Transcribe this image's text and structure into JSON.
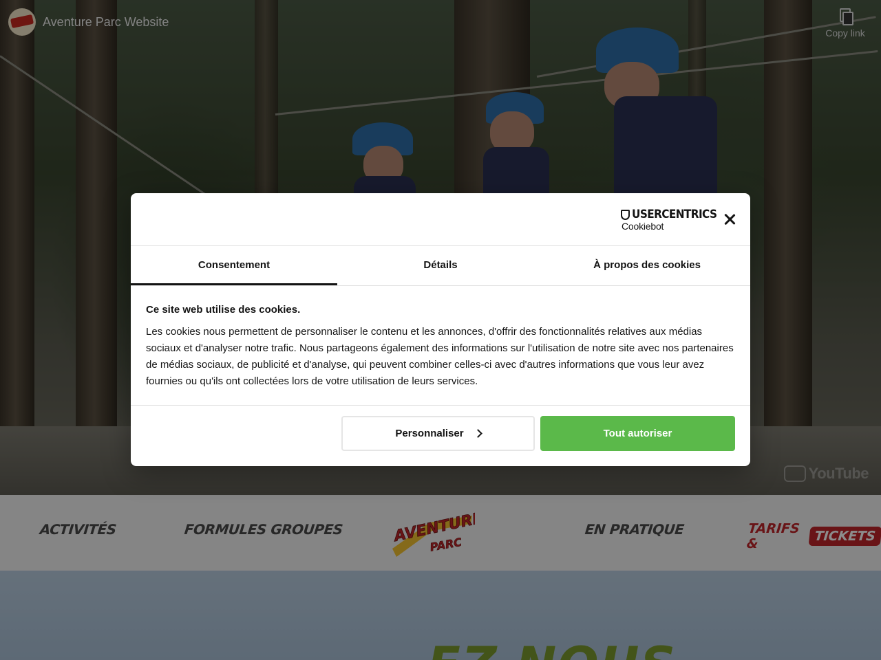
{
  "video": {
    "title": "Aventure Parc Website",
    "copy_link_label": "Copy link",
    "watermark": "YouTube"
  },
  "nav": {
    "activites": "Activités",
    "formules": "Formules Groupes",
    "en_pratique": "En pratique",
    "tarifs": "Tarifs &",
    "tickets": "Tickets",
    "logo_text_1": "AVENTURE",
    "logo_text_2": "PARC"
  },
  "section": {
    "partial_heading": "-EZ-NOUS"
  },
  "cookie_dialog": {
    "brand_top": "USERCENTRICS",
    "brand_bottom": "Cookiebot",
    "tabs": [
      "Consentement",
      "Détails",
      "À propos des cookies"
    ],
    "active_tab": "Consentement",
    "heading": "Ce site web utilise des cookies.",
    "body": "Les cookies nous permettent de personnaliser le contenu et les annonces, d'offrir des fonctionnalités relatives aux médias sociaux et d'analyser notre trafic. Nous partageons également des informations sur l'utilisation de notre site avec nos partenaires de médias sociaux, de publicité et d'analyse, qui peuvent combiner celles-ci avec d'autres informations que vous leur avez fournies ou qu'ils ont collectées lors de votre utilisation de leurs services.",
    "customize_label": "Personnaliser",
    "accept_label": "Tout autoriser"
  },
  "colors": {
    "accept_green": "#5bb94a",
    "brand_red": "#c0262a",
    "overlay": "rgba(0,0,0,0.45)"
  }
}
